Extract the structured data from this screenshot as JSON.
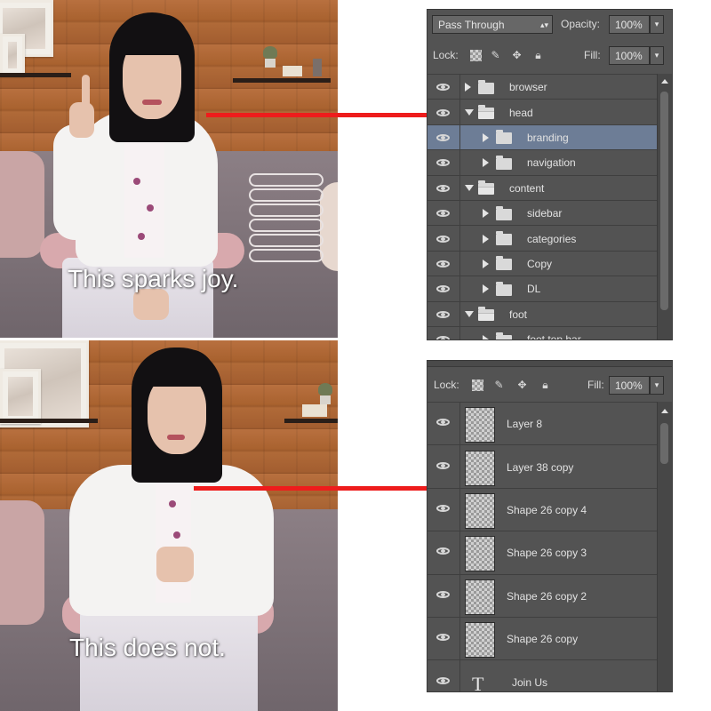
{
  "captions": {
    "top": "This sparks joy.",
    "bottom": "This does not."
  },
  "colors": {
    "arrow": "#ee1c1c",
    "panel_bg": "#535353",
    "selected_row": "#6d7d96"
  },
  "icons": {
    "visibility": "eye-icon",
    "group": "folder-icon",
    "expand": "disclosure-triangle-icon",
    "lock_transparent": "checkerboard-lock-icon",
    "lock_paint": "brush-icon",
    "lock_move": "move-icon",
    "lock_all": "padlock-icon",
    "type_layer": "type-T-icon"
  },
  "top_panel": {
    "blend_mode": "Pass Through",
    "opacity_label": "Opacity:",
    "opacity_value": "100%",
    "lock_label": "Lock:",
    "fill_label": "Fill:",
    "fill_value": "100%",
    "layers": [
      {
        "name": "browser",
        "expanded": false,
        "selected": false
      },
      {
        "name": "head",
        "expanded": true,
        "selected": false
      },
      {
        "name": "branding",
        "expanded": false,
        "selected": true
      },
      {
        "name": "navigation",
        "expanded": false,
        "selected": false
      },
      {
        "name": "content",
        "expanded": true,
        "selected": false
      },
      {
        "name": "sidebar",
        "expanded": false,
        "selected": false
      },
      {
        "name": "categories",
        "expanded": false,
        "selected": false
      },
      {
        "name": "Copy",
        "expanded": false,
        "selected": false
      },
      {
        "name": "DL",
        "expanded": false,
        "selected": false
      },
      {
        "name": "foot",
        "expanded": true,
        "selected": false
      },
      {
        "name": "foot top bar",
        "expanded": false,
        "selected": false
      }
    ]
  },
  "bottom_panel": {
    "lock_label": "Lock:",
    "fill_label": "Fill:",
    "fill_value": "100%",
    "layers": [
      {
        "name": "Layer 8",
        "kind": "pixel"
      },
      {
        "name": "Layer 38 copy",
        "kind": "pixel"
      },
      {
        "name": "Shape 26 copy 4",
        "kind": "pixel"
      },
      {
        "name": "Shape 26 copy 3",
        "kind": "pixel"
      },
      {
        "name": "Shape 26 copy 2",
        "kind": "pixel"
      },
      {
        "name": "Shape 26 copy",
        "kind": "pixel"
      },
      {
        "name": "Join Us",
        "kind": "type",
        "glyph": "T"
      }
    ]
  }
}
